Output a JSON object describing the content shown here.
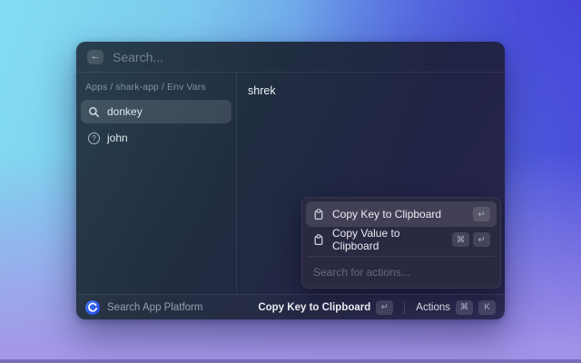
{
  "background": {
    "top_left": "#82def2",
    "top_right": "#4545d8",
    "bottom_left": "#9583e3",
    "bottom_right": "#b3a2ec"
  },
  "window": {
    "header": {
      "back_icon": "←",
      "search_placeholder": "Search..."
    },
    "breadcrumb": "Apps / shark-app / Env Vars",
    "list": [
      {
        "label": "donkey",
        "icon": "magnifier-icon",
        "selected": true
      },
      {
        "label": "john",
        "icon": "question-circle-icon",
        "selected": false,
        "icon_glyph": "?"
      }
    ],
    "detail": {
      "value": "shrek"
    },
    "actions_panel": {
      "items": [
        {
          "label": "Copy Key to Clipboard",
          "icon": "clipboard-icon",
          "keys": [
            "↵"
          ],
          "selected": true
        },
        {
          "label": "Copy Value to Clipboard",
          "icon": "clipboard-icon",
          "keys": [
            "⌘",
            "↵"
          ],
          "selected": false
        }
      ],
      "search_placeholder": "Search for actions..."
    },
    "status_bar": {
      "app_icon": "swirl-logo",
      "app_name": "Search App Platform",
      "primary_action": {
        "label": "Copy Key to Clipboard",
        "key": "↵"
      },
      "actions_button": {
        "label": "Actions",
        "keys": [
          "⌘",
          "K"
        ]
      }
    }
  }
}
